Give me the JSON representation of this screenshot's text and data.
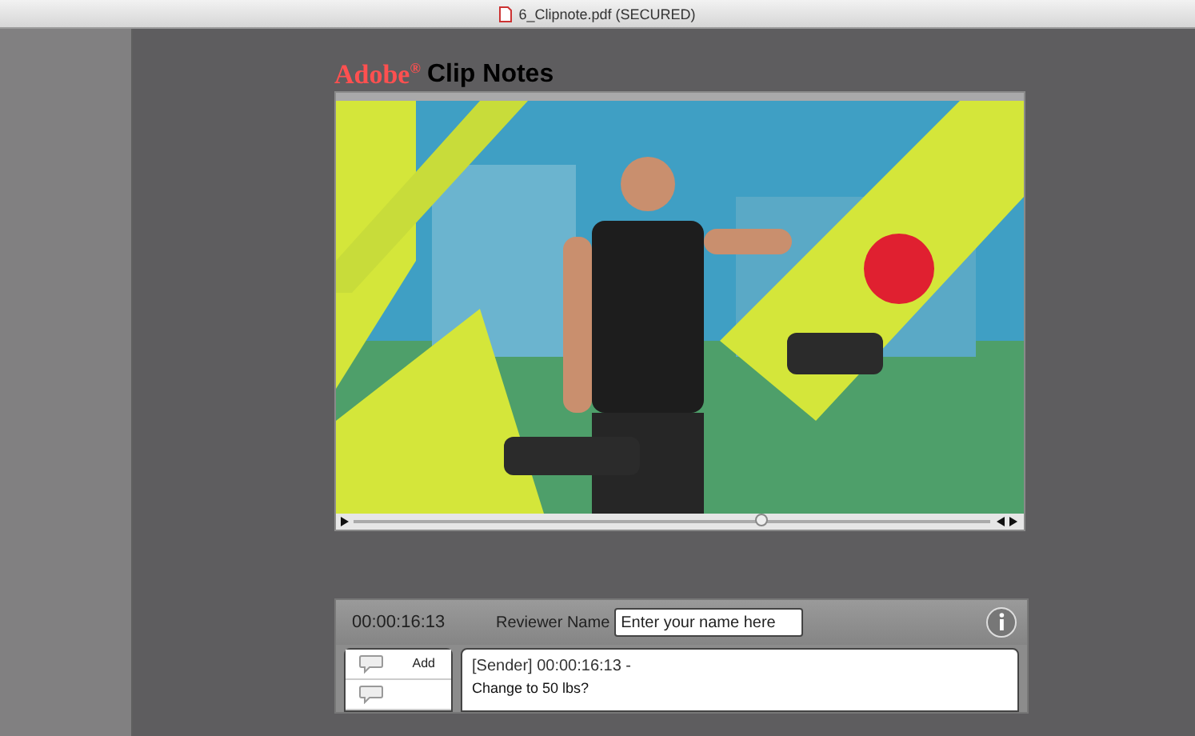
{
  "window": {
    "title": "6_Clipnote.pdf (SECURED)"
  },
  "header": {
    "brand": "Adobe$^{®}$",
    "product": "Clip Notes"
  },
  "video": {
    "kind": "picture",
    "seek": {
      "level": 0.64
    }
  },
  "review_bar": {
    "timecode": "00:00:16:13",
    "reviewer_label": "Reviewer Name",
    "reviewer_field": {
      "placeholder": "Enter your name here"
    }
  },
  "actions": [
    {
      "label": "Add"
    }
  ],
  "comment": {
    "heading": "[Sender] 00:00:16:13 -",
    "body": "Change to 50 lbs?"
  }
}
